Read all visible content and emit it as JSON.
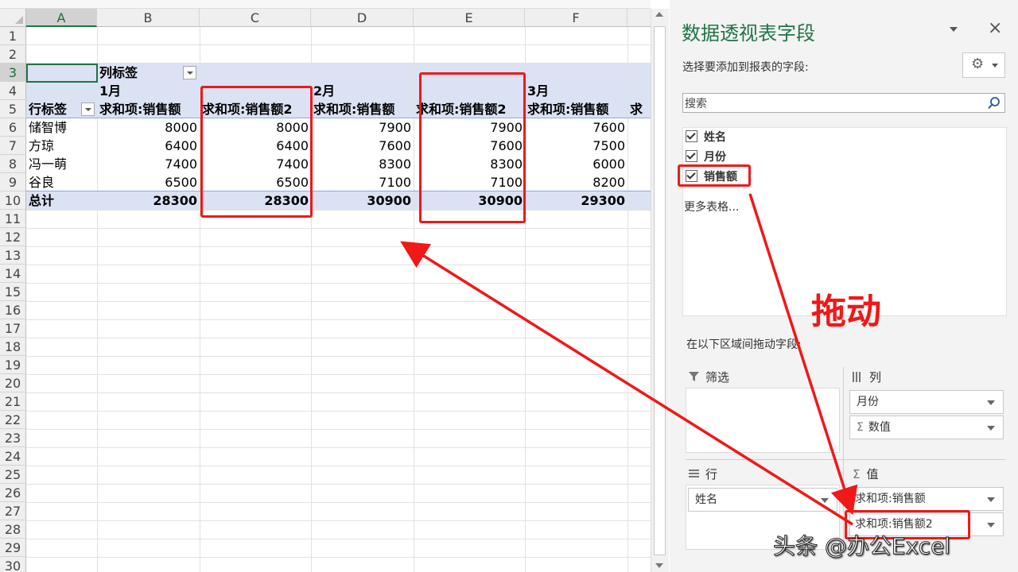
{
  "columns": [
    "A",
    "B",
    "C",
    "D",
    "E",
    "F"
  ],
  "rows": [
    "1",
    "2",
    "3",
    "4",
    "5",
    "6",
    "7",
    "8",
    "9",
    "10",
    "11",
    "12",
    "13",
    "14",
    "15",
    "16",
    "17",
    "18",
    "19",
    "20",
    "21",
    "22",
    "23",
    "24",
    "25",
    "26",
    "27",
    "28",
    "29",
    "30"
  ],
  "pivot": {
    "col_label_caption": "列标签",
    "row_label_caption": "行标签",
    "months": [
      "1月",
      "2月",
      "3月"
    ],
    "measure_headers": [
      "求和项:销售额",
      "求和项:销售额2",
      "求和项:销售额",
      "求和项:销售额2",
      "求和项:销售额",
      "求"
    ],
    "names": [
      "储智博",
      "方琼",
      "冯一萌",
      "谷良"
    ],
    "data": [
      [
        "8000",
        "8000",
        "7900",
        "7900",
        "7600"
      ],
      [
        "6400",
        "6400",
        "7600",
        "7600",
        "7500"
      ],
      [
        "7400",
        "7400",
        "8300",
        "8300",
        "6000"
      ],
      [
        "6500",
        "6500",
        "7100",
        "7100",
        "8200"
      ]
    ],
    "total_label": "总计",
    "totals": [
      "28300",
      "28300",
      "30900",
      "30900",
      "29300"
    ]
  },
  "panel": {
    "title": "数据透视表字段",
    "choose_fields_label": "选择要添加到报表的字段:",
    "search_placeholder": "搜索",
    "fields": [
      "姓名",
      "月份",
      "销售额"
    ],
    "more_tables": "更多表格...",
    "drag_hint": "在以下区域间拖动字段:",
    "zones": {
      "filter": "筛选",
      "columns": "列",
      "rows": "行",
      "values": "值"
    },
    "columns_items": [
      "月份",
      "数值"
    ],
    "rows_items": [
      "姓名"
    ],
    "values_items": [
      "求和项:销售额",
      "求和项:销售额2"
    ]
  },
  "annotation": {
    "drag_text": "拖动",
    "watermark": "头条 @办公Excel"
  },
  "colors": {
    "red": "#f01818",
    "excel_green": "#217346",
    "pivot_band": "#dbe2f3"
  }
}
